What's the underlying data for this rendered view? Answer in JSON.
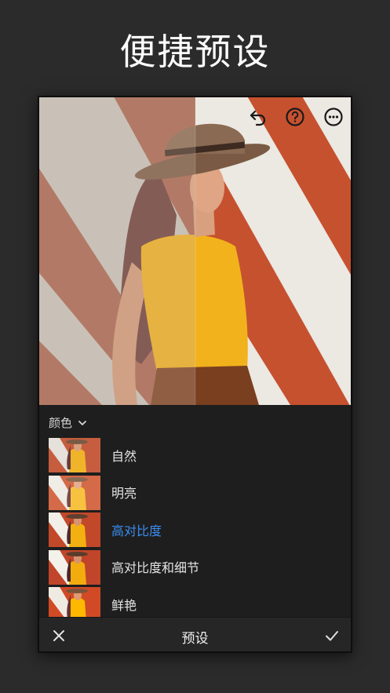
{
  "promo": {
    "title": "便捷预设"
  },
  "toolbar": {
    "icons": [
      "undo-icon",
      "help-icon",
      "more-icon"
    ]
  },
  "panel": {
    "category_label": "颜色",
    "presets": [
      {
        "label": "自然",
        "selected": false
      },
      {
        "label": "明亮",
        "selected": false
      },
      {
        "label": "高对比度",
        "selected": true
      },
      {
        "label": "高对比度和细节",
        "selected": false
      },
      {
        "label": "鲜艳",
        "selected": false
      }
    ]
  },
  "bottom_bar": {
    "title": "预设",
    "cancel_icon": "close-icon",
    "confirm_icon": "check-icon"
  },
  "colors": {
    "background": "#2b2b2b",
    "accent": "#3b8df2",
    "stripe_red": "#c4553a",
    "stripe_white": "#e9e6e1",
    "shirt": "#f2b21c"
  }
}
